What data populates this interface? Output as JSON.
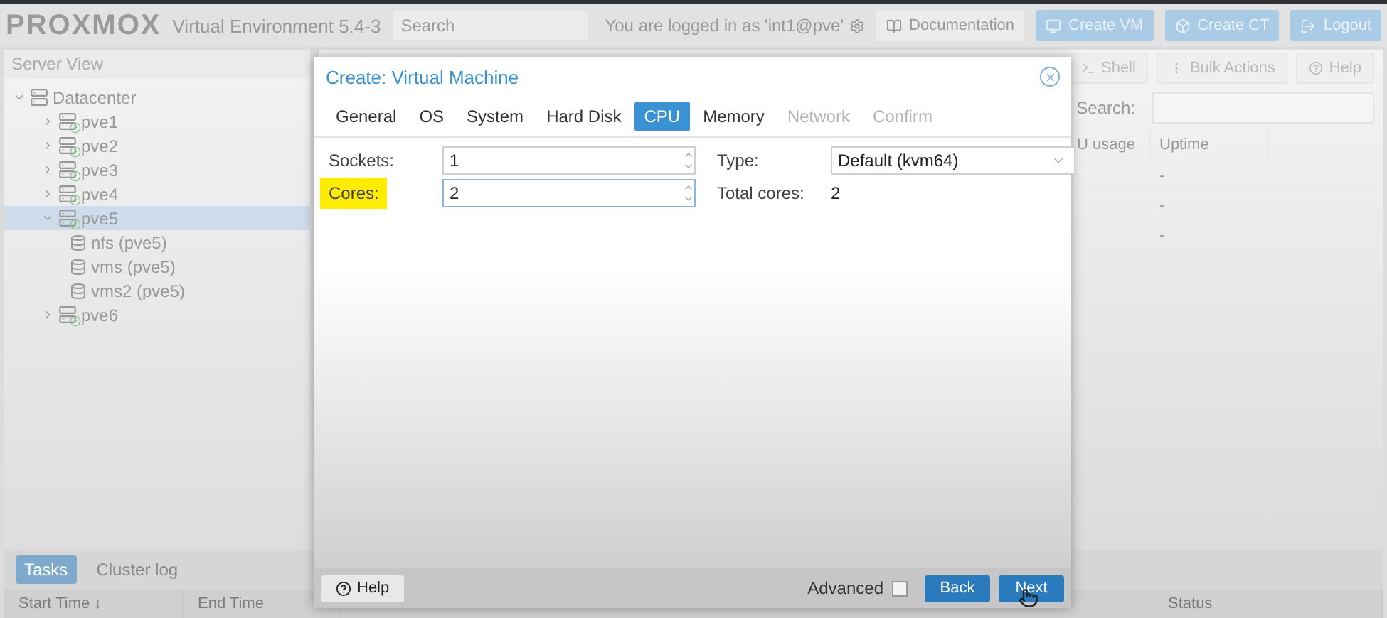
{
  "header": {
    "logo": "PROXMOX",
    "version": "Virtual Environment 5.4-3",
    "search": {
      "placeholder": "Search"
    },
    "login": "You are logged in as 'int1@pve'",
    "buttons": [
      {
        "label": "Documentation",
        "kind": "plain"
      },
      {
        "label": "Create VM",
        "kind": "primary"
      },
      {
        "label": "Create CT",
        "kind": "primary"
      },
      {
        "label": "Logout",
        "kind": "primary"
      }
    ]
  },
  "sidebar": {
    "view": "Server View",
    "tree": [
      {
        "label": "Datacenter",
        "kind": "datacenter",
        "expanded": true,
        "selected": false,
        "children": [
          {
            "label": "pve1",
            "kind": "node",
            "expanded": false,
            "selected": false
          },
          {
            "label": "pve2",
            "kind": "node",
            "expanded": false,
            "selected": false
          },
          {
            "label": "pve3",
            "kind": "node",
            "expanded": false,
            "selected": false
          },
          {
            "label": "pve4",
            "kind": "node",
            "expanded": false,
            "selected": false
          },
          {
            "label": "pve5",
            "kind": "node",
            "expanded": true,
            "selected": true,
            "children": [
              {
                "label": "nfs (pve5)",
                "kind": "storage",
                "selected": false
              },
              {
                "label": "vms (pve5)",
                "kind": "storage",
                "selected": false
              },
              {
                "label": "vms2 (pve5)",
                "kind": "storage",
                "selected": false
              }
            ]
          },
          {
            "label": "pve6",
            "kind": "node",
            "expanded": false,
            "selected": false
          }
        ]
      }
    ]
  },
  "content": {
    "toolbar": [
      {
        "label": "Shell",
        "kind": "shell"
      },
      {
        "label": "Bulk Actions",
        "kind": "bulk"
      },
      {
        "label": "Help",
        "kind": "help"
      }
    ],
    "search_label": "Search:",
    "columns": [
      "U usage",
      "Uptime"
    ],
    "rows": [
      [
        "",
        "-"
      ],
      [
        "",
        "-"
      ],
      [
        "",
        "-"
      ]
    ]
  },
  "bottom": {
    "tabs": [
      {
        "label": "Tasks",
        "selected": true
      },
      {
        "label": "Cluster log",
        "selected": false
      }
    ],
    "columns": [
      "Start Time ↓",
      "End Time",
      "Status"
    ]
  },
  "dialog": {
    "title": "Create: Virtual Machine",
    "tabs": [
      {
        "label": "General",
        "selected": false,
        "disabled": false
      },
      {
        "label": "OS",
        "selected": false,
        "disabled": false
      },
      {
        "label": "System",
        "selected": false,
        "disabled": false
      },
      {
        "label": "Hard Disk",
        "selected": false,
        "disabled": false
      },
      {
        "label": "CPU",
        "selected": true,
        "disabled": false
      },
      {
        "label": "Memory",
        "selected": false,
        "disabled": false
      },
      {
        "label": "Network",
        "selected": false,
        "disabled": true
      },
      {
        "label": "Confirm",
        "selected": false,
        "disabled": true
      }
    ],
    "left_fields": [
      {
        "label": "Sockets:",
        "value": "1",
        "kind": "spinner",
        "focused": false,
        "highlighted": false
      },
      {
        "label": "Cores:",
        "value": "2",
        "kind": "spinner",
        "focused": true,
        "highlighted": true
      }
    ],
    "right_fields": [
      {
        "label": "Type:",
        "value": "Default (kvm64)",
        "kind": "combo"
      },
      {
        "label": "Total cores:",
        "value": "2",
        "kind": "display"
      }
    ],
    "footer": {
      "help": "Help",
      "advanced": {
        "label": "Advanced",
        "checked": false
      },
      "back": "Back",
      "next": "Next"
    }
  }
}
